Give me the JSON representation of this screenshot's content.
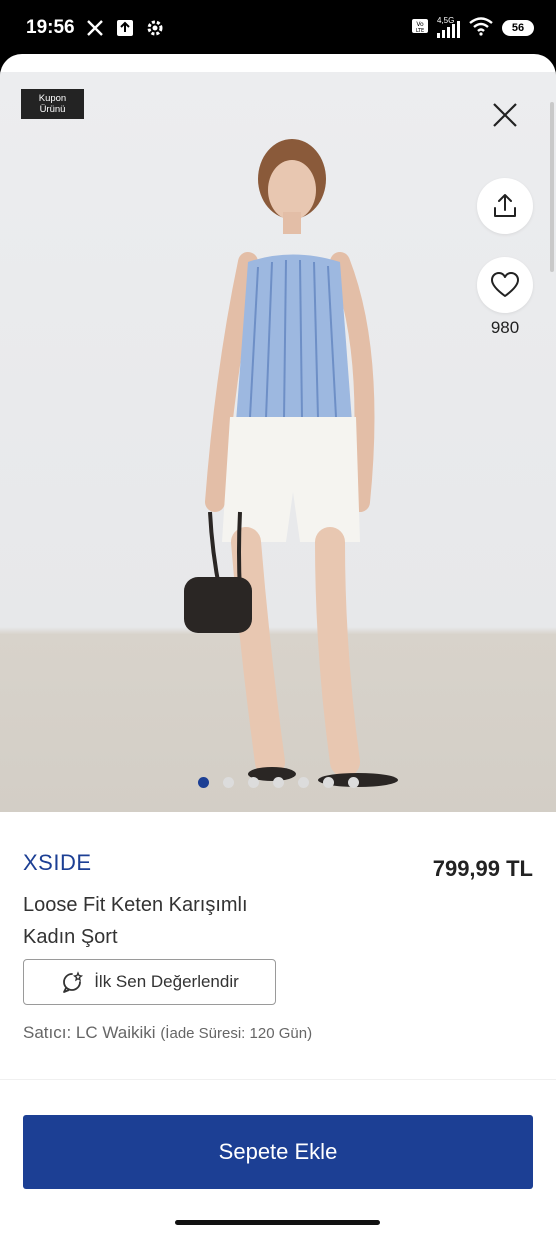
{
  "status_bar": {
    "time": "19:56",
    "network": "4,5G",
    "lte_badge": "Vo LTE",
    "battery": "56"
  },
  "product": {
    "coupon_tag_line1": "Kupon",
    "coupon_tag_line2": "Ürünü",
    "favorite_count": "980",
    "image_count": 7,
    "active_image": 1,
    "brand": "XSIDE",
    "price": "799,99 TL",
    "title_line1": "Loose Fit Keten Karışımlı",
    "title_line2": "Kadın Şort",
    "review_label": "İlk Sen Değerlendir",
    "seller_label": "Satıcı: LC Waikiki",
    "return_label": "(İade Süresi: 120 Gün)"
  },
  "actions": {
    "add_to_cart_label": "Sepete Ekle"
  },
  "colors": {
    "accent": "#1c3f94"
  }
}
